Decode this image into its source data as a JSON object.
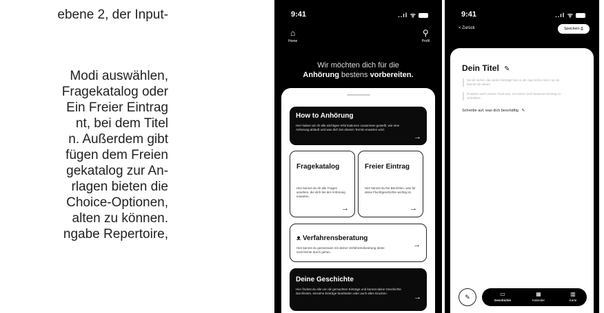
{
  "document": {
    "lines": [
      "ebene 2, der Input-",
      "Modi auswählen,",
      "Fragekatalog oder",
      "Ein Freier Eintrag",
      "nt, bei dem Titel",
      "n. Außerdem gibt",
      "fügen dem Freien",
      "gekatalog zur An-",
      "rlagen bieten die",
      "Choice-Optionen,",
      "alten zu können.",
      "ngabe Repertoire,"
    ]
  },
  "phone1": {
    "status": {
      "time": "9:41",
      "icons": "..ıl ᯤ"
    },
    "nav": {
      "home_icon": "⌂",
      "home_label": "Home",
      "profile_icon": "⚲",
      "profile_label": "Profil"
    },
    "hero": {
      "line1": "Wir möchten dich für die",
      "bold1": "Anhörung",
      "mid": " bestens ",
      "bold2": "vorbereiten."
    },
    "cards": {
      "how": {
        "title": "How to Anhörung",
        "desc": "Hier haben wir dir alle wichtigen Informationen zusammen gestellt, wie eine Anhörung abläuft und was dich bei diesem Termin erwarten wird."
      },
      "fragekatalog": {
        "title": "Fragekatalog",
        "desc": "Hier kannst du dir alle Fragen ansehen, die dich bei der Anhörung erwarten."
      },
      "freier": {
        "title": "Freier Eintrag",
        "desc": "Hier kannst du frei Berichten, was für deine Fluchtgeschichte wichtig ist."
      },
      "verfahren": {
        "icon": "ᴥ",
        "title": "Verfahrensberatung",
        "desc": "Hier kannst du gemeinsam mit deiner Verfahrensbeartung deine Geschichte durch gehen."
      },
      "geschichte": {
        "title": "Deine Geschichte",
        "desc": "Hier findest du alle von dir gemachten Einträge und kannst deine Geschichte durchlesen, einzelne Einträge bearbeiten oder auch alles Drucken."
      }
    },
    "arrow": "→"
  },
  "phone2": {
    "status": {
      "time": "9:41",
      "icons": "..ıl ᯤ"
    },
    "back_label": "< Zurück",
    "save_label": "Speichern ⎙",
    "title": "Dein Titel",
    "edit_icon": "✎",
    "hint1": "Sei dir sicher, das deine Einträge hier in der App sicher sind, nur du kannst sie sehen.",
    "hint2": "Probiere auch unsere Tools aus, um einen noch besseren Eintrag zu schreiben.",
    "prompt": "Schreibe auf, was dich beschäftig",
    "pen_icon": "✎",
    "tabs": [
      {
        "icon": "▭",
        "label": "Geschichte"
      },
      {
        "icon": "▦",
        "label": "Kalender"
      },
      {
        "icon": "▥",
        "label": "Karte"
      }
    ]
  }
}
